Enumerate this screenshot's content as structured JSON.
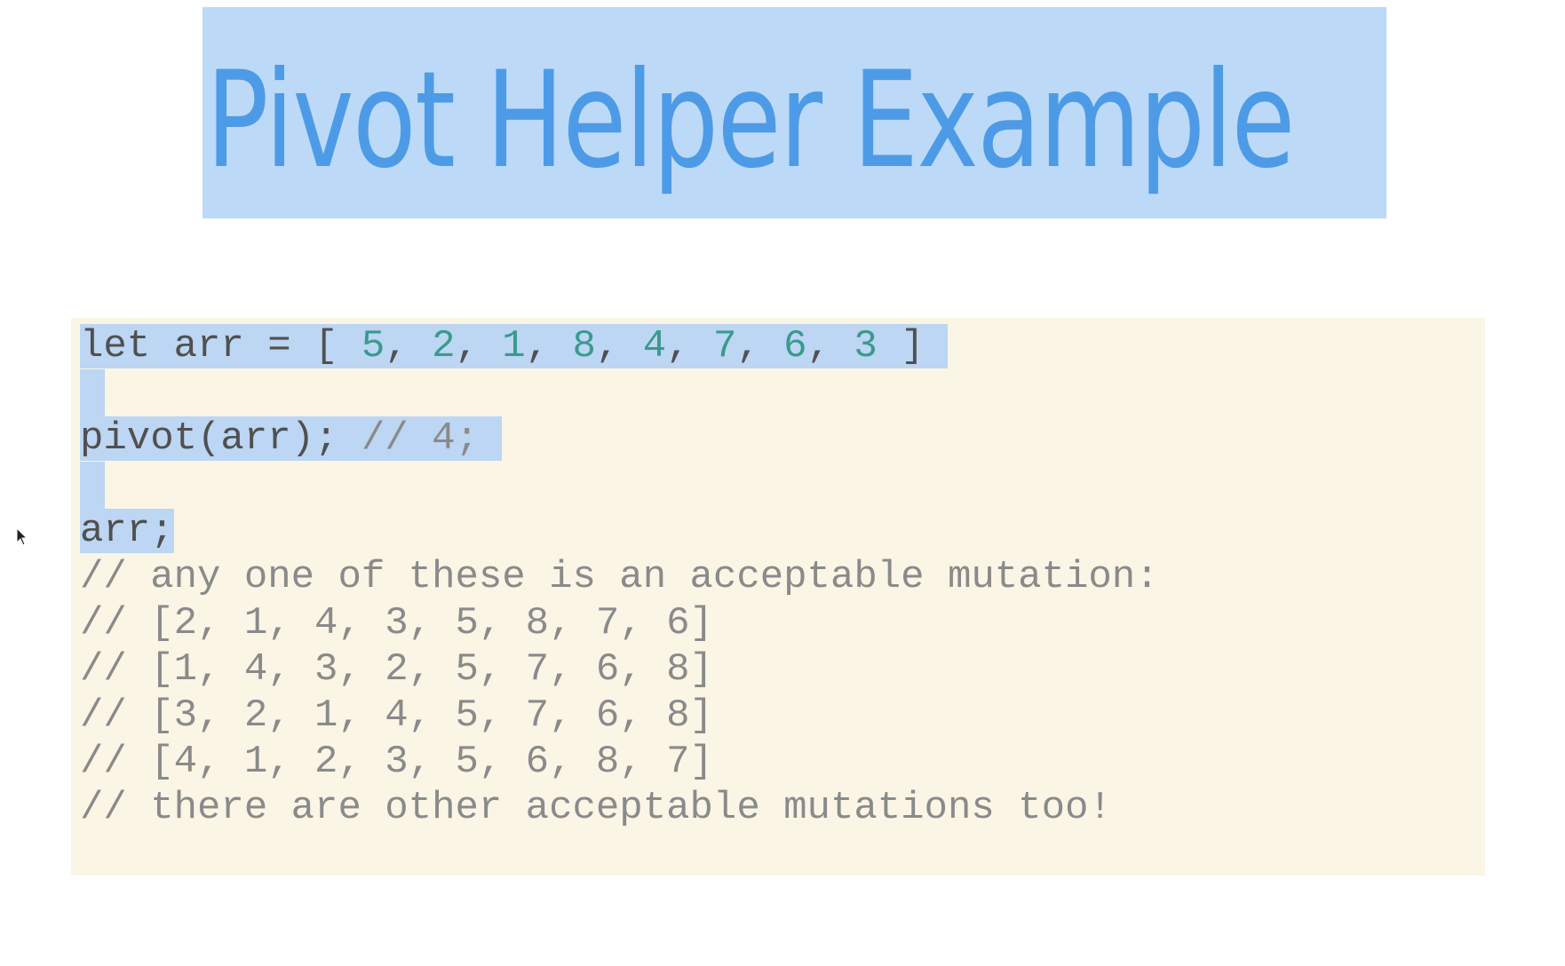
{
  "slide": {
    "title": "Pivot Helper Example"
  },
  "code": {
    "line1": {
      "prefix": "let arr = [ ",
      "nums": [
        "5",
        "2",
        "1",
        "8",
        "4",
        "7",
        "6",
        "3"
      ],
      "suffix": " ]"
    },
    "line2": {
      "call": "pivot(arr); ",
      "comment": "// 4;"
    },
    "line3": "arr;",
    "comment1": "// any one of these is an acceptable mutation:",
    "comment2": "// [2, 1, 4, 3, 5, 8, 7, 6]",
    "comment3": "// [1, 4, 3, 2, 5, 7, 6, 8]",
    "comment4": "// [3, 2, 1, 4, 5, 7, 6, 8]",
    "comment5": "// [4, 1, 2, 3, 5, 6, 8, 7]",
    "comment6": "// there are other acceptable mutations too!"
  },
  "colors": {
    "title_text": "#4d9be6",
    "title_bg": "#bcd9f7",
    "code_bg": "#fbf5e6",
    "number": "#3a9a8c",
    "comment": "#8a8a8a",
    "selection": "#bcd6f3"
  },
  "icons": {
    "cursor": "mouse-pointer-icon"
  }
}
